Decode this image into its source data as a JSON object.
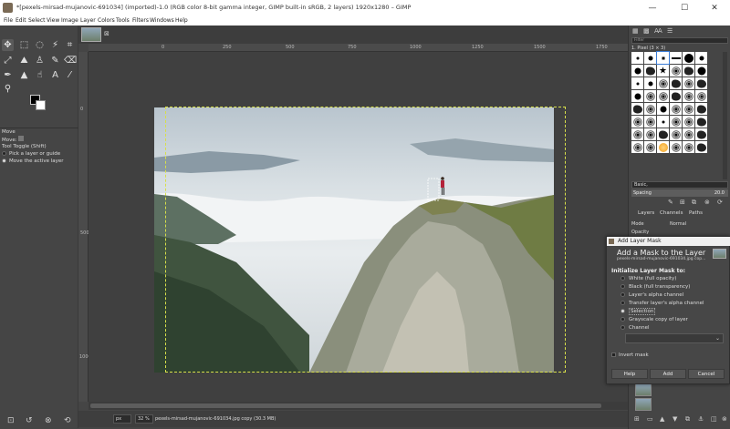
{
  "window": {
    "title": "*[pexels-mirsad-mujanovic-691034] (imported)-1.0 (RGB color 8-bit gamma integer, GIMP built-in sRGB, 2 layers) 1920x1280 – GIMP",
    "minimize": "—",
    "maximize": "☐",
    "close": "✕"
  },
  "menu": [
    "File",
    "Edit",
    "Select",
    "View",
    "Image",
    "Layer",
    "Colors",
    "Tools",
    "Filters",
    "Windows",
    "Help"
  ],
  "tool_options": {
    "title": "Move",
    "mode_label": "Move:",
    "tool_toggle": "Tool Toggle  (Shift)",
    "option1": "Pick a layer or guide",
    "option2": "Move the active layer"
  },
  "image_tab": {
    "close": "⊠"
  },
  "ruler": {
    "h_labels": [
      "0",
      "250",
      "500",
      "750",
      "1000",
      "1250",
      "1500",
      "1750"
    ],
    "v_labels": [
      "0",
      "500",
      "1000"
    ]
  },
  "status": {
    "unit": "px",
    "zoom": "32 %",
    "text": "pexels-mirsad-mujanovic-691034.jpg copy (30.3 MB)"
  },
  "brushes": {
    "filter_placeholder": "Filter",
    "selected_name": "1. Pixel (3 × 3)",
    "preset": "Basic,",
    "spacing_label": "Spacing",
    "spacing_value": "20.0"
  },
  "layers_panel": {
    "tabs": [
      "Layers",
      "Channels",
      "Paths"
    ],
    "mode_label": "Mode",
    "mode_value": "Normal",
    "opacity_label": "Opacity"
  },
  "dialog": {
    "window_title": "Add Layer Mask",
    "heading": "Add a Mask to the Layer",
    "subtitle": "pexels-mirsad-mujanovic-691034.jpg cop...",
    "init_label": "Initialize Layer Mask to:",
    "options": [
      "White (full opacity)",
      "Black (full transparency)",
      "Layer's alpha channel",
      "Transfer layer's alpha channel",
      "Selection",
      "Grayscale copy of layer",
      "Channel"
    ],
    "selected_index": 4,
    "invert_label": "Invert mask",
    "buttons": {
      "help": "Help",
      "add": "Add",
      "cancel": "Cancel"
    }
  },
  "colors": {
    "selection_outline": "#d8e04a",
    "hiker_jacket": "#b4223a"
  }
}
